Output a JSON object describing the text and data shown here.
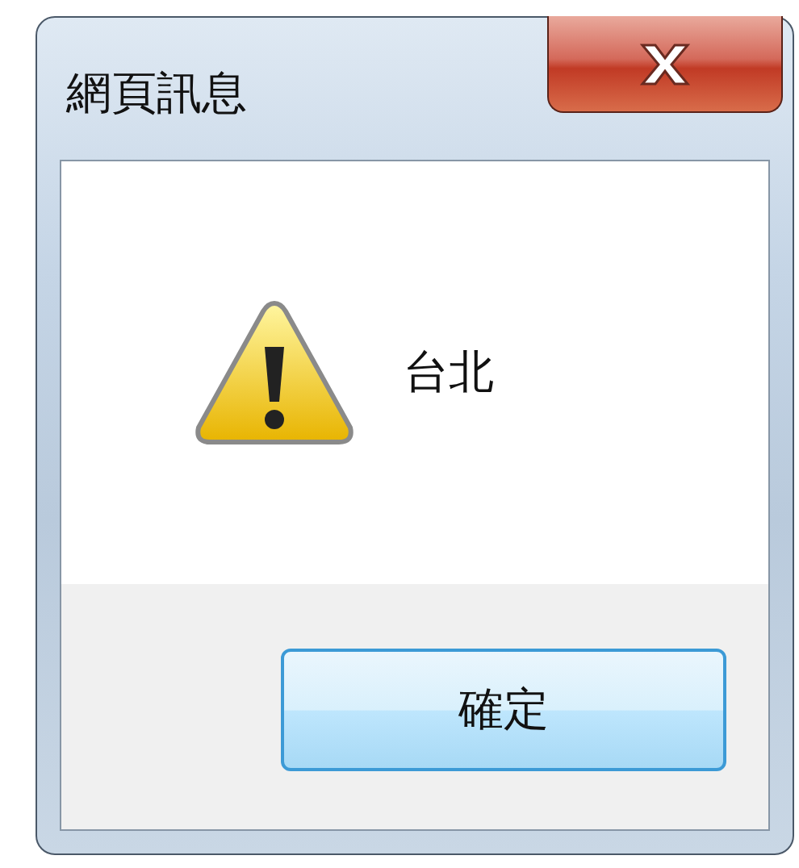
{
  "window": {
    "title": "網頁訊息"
  },
  "message": "台北",
  "buttons": [
    {
      "label": "確定"
    }
  ]
}
